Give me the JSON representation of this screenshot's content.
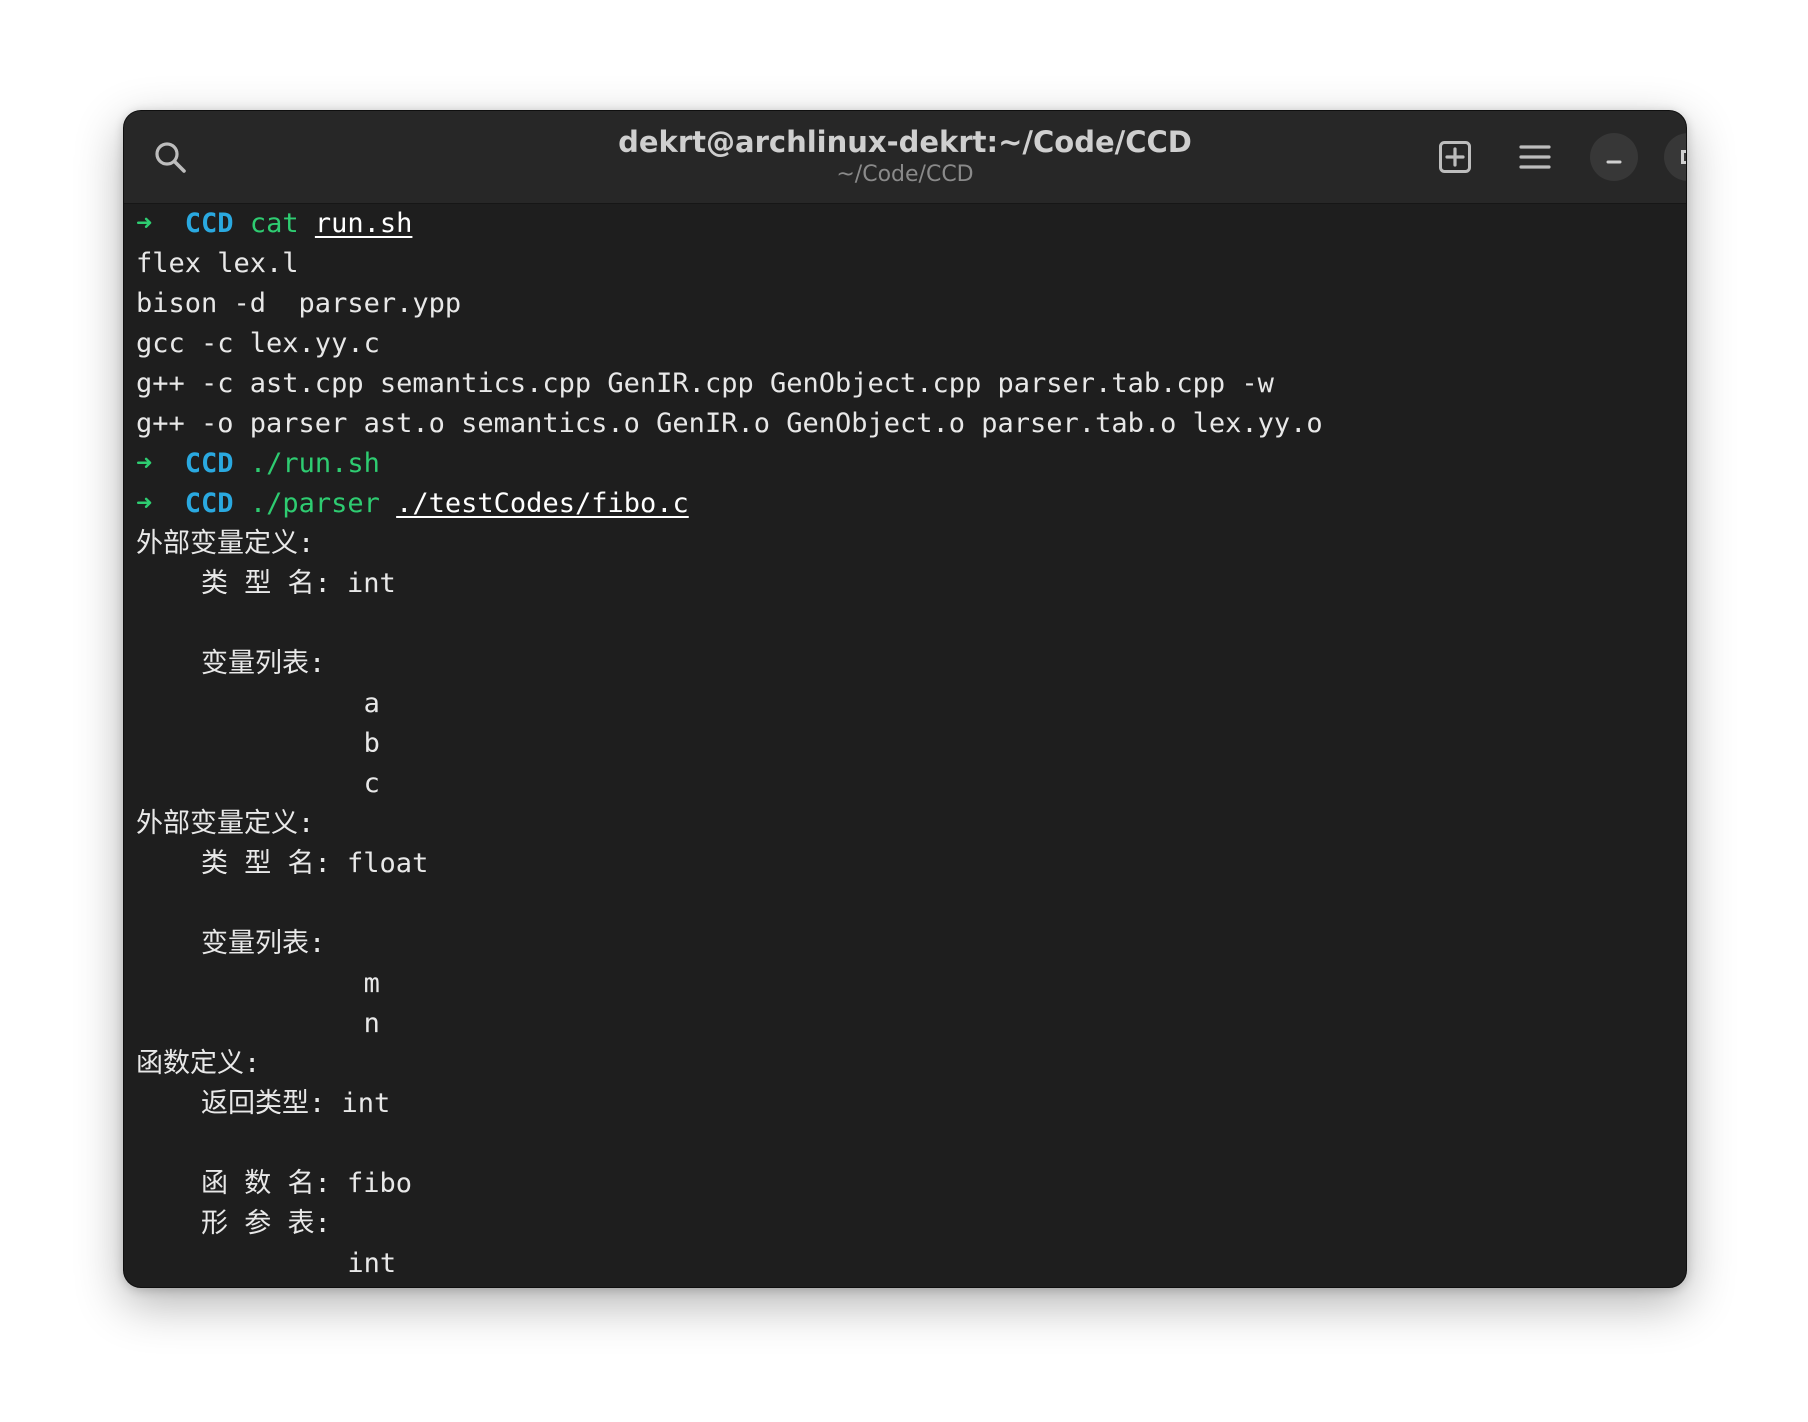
{
  "window": {
    "title": "dekrt@archlinux-dekrt:~/Code/CCD",
    "subtitle": "~/Code/CCD"
  },
  "icons": {
    "search": "search-icon",
    "new_tab": "new-tab-icon",
    "menu": "hamburger-menu-icon",
    "minimize": "minimize-icon",
    "maximize": "maximize-icon",
    "close": "close-icon"
  },
  "colors": {
    "prompt_arrow": "#2ecc71",
    "prompt_dir": "#2aa9e0",
    "command": "#2ecc71",
    "background": "#1e1e1e"
  },
  "terminal": {
    "prompt_arrow": "➜",
    "prompt_dir": "CCD",
    "lines": [
      {
        "type": "prompt",
        "cmd": "cat",
        "arg": "run.sh"
      },
      {
        "type": "text",
        "text": "flex lex.l"
      },
      {
        "type": "text",
        "text": "bison -d  parser.ypp"
      },
      {
        "type": "text",
        "text": "gcc -c lex.yy.c"
      },
      {
        "type": "text",
        "text": "g++ -c ast.cpp semantics.cpp GenIR.cpp GenObject.cpp parser.tab.cpp -w"
      },
      {
        "type": "text",
        "text": "g++ -o parser ast.o semantics.o GenIR.o GenObject.o parser.tab.o lex.yy.o"
      },
      {
        "type": "prompt",
        "cmd": "./run.sh",
        "arg": ""
      },
      {
        "type": "prompt",
        "cmd": "./parser",
        "arg": "./testCodes/fibo.c"
      },
      {
        "type": "text",
        "text": "外部变量定义:"
      },
      {
        "type": "text",
        "text": "    类 型 名: int"
      },
      {
        "type": "text",
        "text": ""
      },
      {
        "type": "text",
        "text": "    变量列表:"
      },
      {
        "type": "text",
        "text": "              a"
      },
      {
        "type": "text",
        "text": "              b"
      },
      {
        "type": "text",
        "text": "              c"
      },
      {
        "type": "text",
        "text": "外部变量定义:"
      },
      {
        "type": "text",
        "text": "    类 型 名: float"
      },
      {
        "type": "text",
        "text": ""
      },
      {
        "type": "text",
        "text": "    变量列表:"
      },
      {
        "type": "text",
        "text": "              m"
      },
      {
        "type": "text",
        "text": "              n"
      },
      {
        "type": "text",
        "text": "函数定义:"
      },
      {
        "type": "text",
        "text": "    返回类型: int"
      },
      {
        "type": "text",
        "text": ""
      },
      {
        "type": "text",
        "text": "    函 数 名: fibo"
      },
      {
        "type": "text",
        "text": "    形 参 表:"
      },
      {
        "type": "text",
        "text": "             int"
      }
    ]
  }
}
